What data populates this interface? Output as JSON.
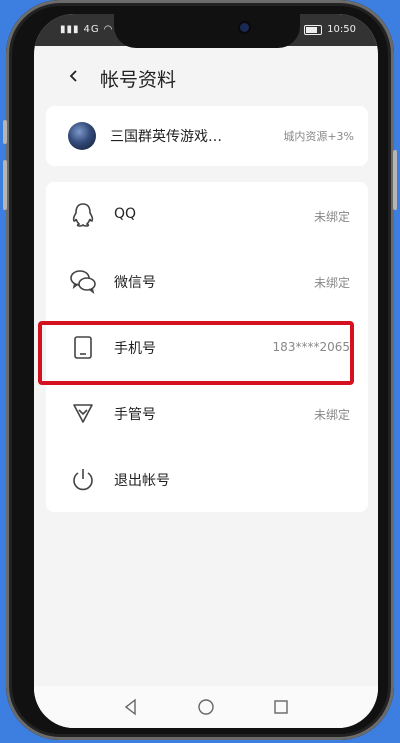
{
  "status_bar": {
    "carrier_text": "4G",
    "time": "10:50"
  },
  "header": {
    "back_icon": "chevron-left-icon",
    "title": "帐号资料"
  },
  "profile": {
    "name": "三国群英传游戏…",
    "tag": "城内资源+3%"
  },
  "rows": [
    {
      "icon": "qq-icon",
      "label": "QQ",
      "value": "未绑定"
    },
    {
      "icon": "wechat-icon",
      "label": "微信号",
      "value": "未绑定"
    },
    {
      "icon": "phone-icon",
      "label": "手机号",
      "value": "183****2065"
    },
    {
      "icon": "shield-icon",
      "label": "手管号",
      "value": "未绑定"
    },
    {
      "icon": "power-icon",
      "label": "退出帐号",
      "value": ""
    }
  ],
  "colors": {
    "background": "#3d7fe0",
    "highlight": "#d4111e",
    "screen": "#f4f4f4",
    "card": "#ffffff"
  },
  "nav": [
    "back-triangle-icon",
    "home-circle-icon",
    "recents-square-icon"
  ]
}
